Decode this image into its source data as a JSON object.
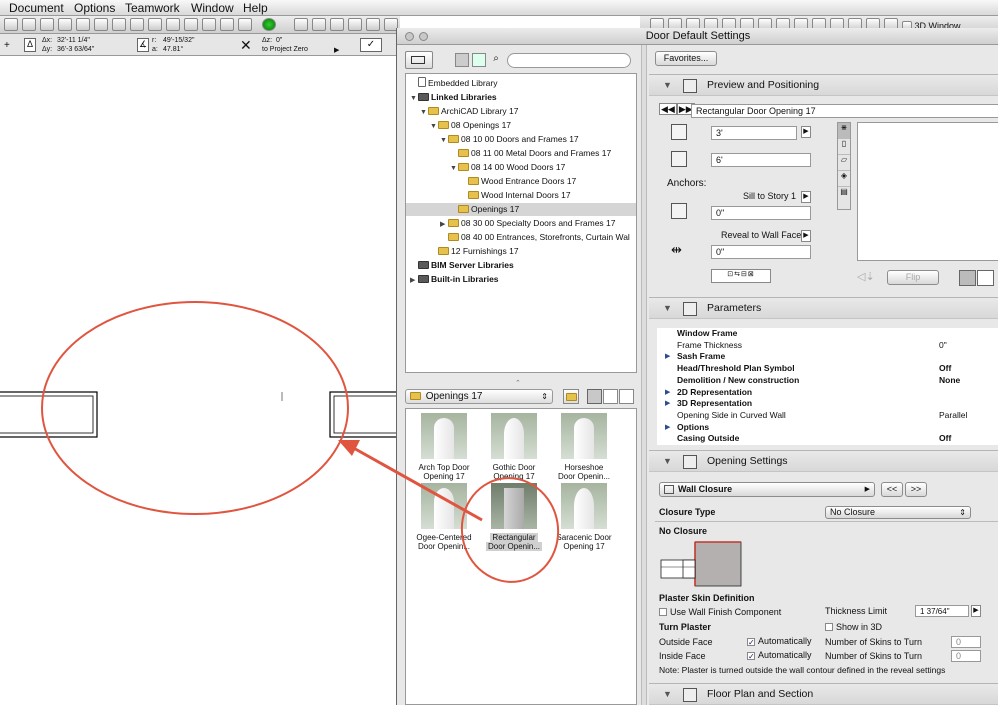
{
  "menu": [
    "Document",
    "Options",
    "Teamwork",
    "Window",
    "Help"
  ],
  "toolbar_right": {
    "window3d": "3D Window"
  },
  "infobox": {
    "dx_label": "Δx:",
    "dx": "32'-11 1/4\"",
    "dy_label": "Δy:",
    "dy": "36'-3 63/64\"",
    "r_label": "r:",
    "r": "49'-15/32\"",
    "a_label": "a:",
    "a": "47.81°",
    "dz_label": "Δz:",
    "dz": "0\"",
    "zero": "to Project Zero"
  },
  "dialog": {
    "title": "Door Default Settings",
    "favorites": "Favorites...",
    "tree": [
      {
        "label": "Embedded Library",
        "indent": 0,
        "arrow": "",
        "icon": "file"
      },
      {
        "label": "Linked Libraries",
        "indent": 0,
        "arrow": "▼",
        "icon": "folder",
        "bold": true
      },
      {
        "label": "ArchiCAD Library 17",
        "indent": 1,
        "arrow": "▼",
        "icon": "folder"
      },
      {
        "label": "08 Openings 17",
        "indent": 2,
        "arrow": "▼",
        "icon": "folder"
      },
      {
        "label": "08 10 00 Doors and Frames 17",
        "indent": 3,
        "arrow": "▼",
        "icon": "folder"
      },
      {
        "label": "08 11 00 Metal Doors and Frames 17",
        "indent": 4,
        "arrow": "",
        "icon": "folder"
      },
      {
        "label": "08 14 00 Wood Doors 17",
        "indent": 4,
        "arrow": "▼",
        "icon": "folder"
      },
      {
        "label": "Wood Entrance Doors 17",
        "indent": 5,
        "arrow": "",
        "icon": "folder"
      },
      {
        "label": "Wood Internal Doors 17",
        "indent": 5,
        "arrow": "",
        "icon": "folder"
      },
      {
        "label": "Openings 17",
        "indent": 4,
        "arrow": "",
        "icon": "folder",
        "selected": true
      },
      {
        "label": "08 30 00 Specialty Doors and Frames 17",
        "indent": 3,
        "arrow": "▶",
        "icon": "folder"
      },
      {
        "label": "08 40 00 Entrances, Storefronts, Curtain Wal",
        "indent": 3,
        "arrow": "",
        "icon": "folder"
      },
      {
        "label": "12 Furnishings 17",
        "indent": 2,
        "arrow": "",
        "icon": "folder"
      },
      {
        "label": "BIM Server Libraries",
        "indent": 0,
        "arrow": "",
        "icon": "folder",
        "bold": true
      },
      {
        "label": "Built-in Libraries",
        "indent": 0,
        "arrow": "▶",
        "icon": "folder",
        "bold": true
      }
    ],
    "folder_select": "Openings 17",
    "gallery": [
      {
        "line1": "Arch Top Door",
        "line2": "Opening 17"
      },
      {
        "line1": "Gothic Door",
        "line2": "Opening 17"
      },
      {
        "line1": "Horseshoe",
        "line2": "Door Openin..."
      },
      {
        "line1": "Ogee-Centered",
        "line2": "Door Openin..."
      },
      {
        "line1": "Rectangular",
        "line2": "Door Openin..."
      },
      {
        "line1": "Saracenic Door",
        "line2": "Opening 17"
      }
    ],
    "preview": {
      "header": "Preview and Positioning",
      "name": "Rectangular Door Opening 17",
      "width": "3'",
      "height": "6'",
      "anchors": "Anchors:",
      "sill": "Sill to Story 1",
      "sill_value": "0\"",
      "reveal": "Reveal to Wall Face",
      "reveal_value": "0\"",
      "flip": "Flip"
    },
    "parameters": {
      "header": "Parameters",
      "rows": [
        {
          "label": "Window Frame",
          "value": "",
          "bold": true,
          "arrow": ""
        },
        {
          "label": "Frame Thickness",
          "value": "0\"",
          "bold": false,
          "arrow": ""
        },
        {
          "label": "Sash Frame",
          "value": "",
          "bold": true,
          "arrow": "▶"
        },
        {
          "label": "Head/Threshold Plan Symbol",
          "value": "Off",
          "bold": true,
          "arrow": ""
        },
        {
          "label": "Demolition / New construction",
          "value": "None",
          "bold": true,
          "arrow": ""
        },
        {
          "label": "2D Representation",
          "value": "",
          "bold": true,
          "arrow": "▶"
        },
        {
          "label": "3D Representation",
          "value": "",
          "bold": true,
          "arrow": "▶"
        },
        {
          "label": "Opening Side in Curved Wall",
          "value": "Parallel",
          "bold": false,
          "arrow": ""
        },
        {
          "label": "Options",
          "value": "",
          "bold": true,
          "arrow": "▶"
        },
        {
          "label": "Casing Outside",
          "value": "Off",
          "bold": true,
          "arrow": ""
        }
      ]
    },
    "opening": {
      "header": "Opening Settings",
      "wall_closure": "Wall Closure",
      "prev": "<<",
      "next": ">>",
      "closure_type_label": "Closure Type",
      "closure_type": "No Closure",
      "no_closure": "No Closure",
      "plaster_skin": "Plaster Skin Definition",
      "use_wall_finish": "Use Wall Finish Component",
      "thickness_limit": "Thickness Limit",
      "thickness_value": "1 37/64\"",
      "turn_plaster": "Turn Plaster",
      "show_in_3d": "Show in 3D",
      "outside_face": "Outside Face",
      "inside_face": "Inside Face",
      "automatically": "Automatically",
      "num_skins": "Number of Skins to Turn",
      "skins_outside": "0",
      "skins_inside": "0",
      "note": "Note: Plaster is turned outside the wall contour defined in the reveal settings"
    },
    "floor_plan": {
      "header": "Floor Plan and Section"
    }
  },
  "colors": {
    "annotation": "#e0553f",
    "folder": "#e6c24c",
    "selection": "#d5d5d5"
  }
}
